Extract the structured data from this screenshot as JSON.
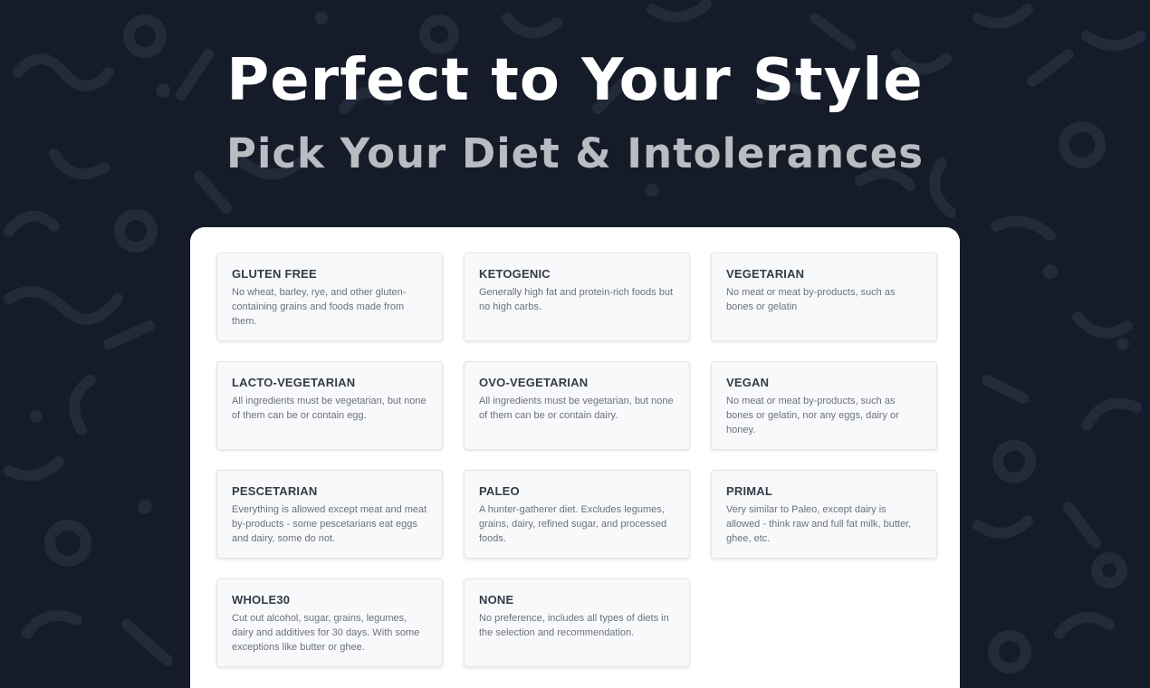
{
  "hero": {
    "title": "Perfect to Your Style",
    "subtitle": "Pick Your Diet & Intolerances"
  },
  "diets": [
    {
      "title": "GLUTEN FREE",
      "description": "No wheat, barley, rye, and other gluten-containing grains and foods made from them."
    },
    {
      "title": "KETOGENIC",
      "description": "Generally high fat and protein-rich foods but no high carbs."
    },
    {
      "title": "VEGETARIAN",
      "description": "No meat or meat by-products, such as bones or gelatin"
    },
    {
      "title": "LACTO-VEGETARIAN",
      "description": "All ingredients must be vegetarian, but none of them can be or contain egg."
    },
    {
      "title": "OVO-VEGETARIAN",
      "description": "All ingredients must be vegetarian, but none of them can be or contain dairy."
    },
    {
      "title": "VEGAN",
      "description": "No meat or meat by-products, such as bones or gelatin, nor any eggs, dairy or honey."
    },
    {
      "title": "PESCETARIAN",
      "description": "Everything is allowed except meat and meat by-products - some pescetarians eat eggs and dairy, some do not."
    },
    {
      "title": "PALEO",
      "description": "A hunter-gatherer diet. Excludes legumes, grains, dairy, refined sugar, and processed foods."
    },
    {
      "title": "PRIMAL",
      "description": "Very similar to Paleo, except dairy is allowed - think raw and full fat milk, butter, ghee, etc."
    },
    {
      "title": "WHOLE30",
      "description": "Cut out alcohol, sugar, grains, legumes, dairy and additives for 30 days. With some exceptions like butter or ghee."
    },
    {
      "title": "NONE",
      "description": "No preference, includes all types of diets in the selection and recommendation."
    }
  ]
}
